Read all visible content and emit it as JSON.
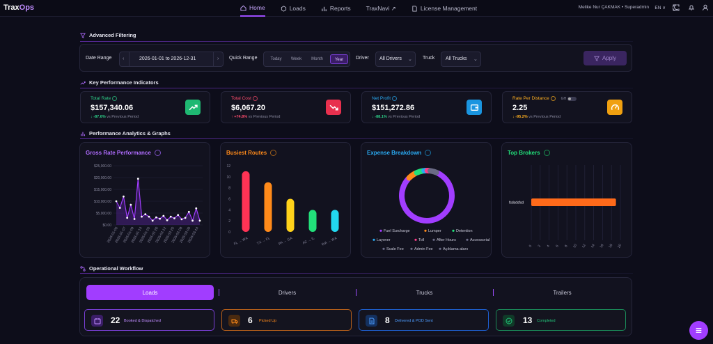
{
  "brand": {
    "name_a": "Trax",
    "name_b": "Ops"
  },
  "nav": [
    {
      "label": "Home",
      "icon": "home-icon"
    },
    {
      "label": "Loads",
      "icon": "box-icon"
    },
    {
      "label": "Reports",
      "icon": "bar-chart-icon"
    },
    {
      "label": "TraxNavi ↗",
      "icon": ""
    },
    {
      "label": "License Management",
      "icon": "document-icon"
    }
  ],
  "user": {
    "name": "Melike Nur ÇAKMAK • Superadmin",
    "lang": "EN ∨"
  },
  "sections": {
    "filtering": "Advanced Filtering",
    "kpi": "Key Performance Indicators",
    "analytics": "Performance Analytics & Graphs",
    "workflow": "Operational Workflow"
  },
  "filter": {
    "date_range_label": "Date Range",
    "date_range_value": "2026-01-01 to 2026-12-31",
    "quick_range_label": "Quick Range",
    "quick_options": [
      "Today",
      "Week",
      "Month",
      "Year"
    ],
    "quick_selected": "Year",
    "driver_label": "Driver",
    "driver_value": "All Drivers",
    "truck_label": "Truck",
    "truck_value": "All Trucks",
    "apply_label": "Apply"
  },
  "kpis": [
    {
      "label": "Total Rate",
      "value": "$157,340.06",
      "change": "-87.6%",
      "suffix": "vs Previous Period",
      "color": "#2ed18a"
    },
    {
      "label": "Total Cost",
      "value": "$6,067.20",
      "change": "+74.8%",
      "suffix": "vs Previous Period",
      "color": "#ff4d6d"
    },
    {
      "label": "Net Profit",
      "value": "$151,272.86",
      "change": "-88.1%",
      "suffix": "vs Previous Period",
      "color": "#2aa9f0"
    },
    {
      "label": "Rate Per Distance",
      "value": "2.25",
      "change": "-95.2%",
      "suffix": "vs Previous Period",
      "color": "#ffb020",
      "toggle_label": "GH"
    }
  ],
  "cards": {
    "gross": "Gross Rate Performance",
    "routes": "Busiest Routes",
    "expense": "Expense Breakdown",
    "brokers": "Top Brokers"
  },
  "chart_data": [
    {
      "type": "line",
      "title": "Gross Rate Performance",
      "x": [
        "2026-01-05",
        "2026-01-07",
        "2026-01-09",
        "2026-01-11",
        "2026-01-13",
        "2026-01-16",
        "2026-01-20",
        "2026-01-23",
        "2026-01-26",
        "2026-01-29",
        "2026-02-02",
        "2026-02-06",
        "2026-02-09",
        "2026-02-12",
        "2026-02-16",
        "2026-02-20",
        "2026-02-24",
        "2026-02-28",
        "2026-03-03",
        "2026-03-06",
        "2026-03-09",
        "2026-03-12",
        "2026-03-14",
        "2026-03-16"
      ],
      "x_tick_labels": [
        "2026-01-05",
        "2026-01-07",
        "2026-01-09",
        "2026-01-13",
        "2026-01-20",
        "2026-01-26",
        "2026-02-12",
        "2026-02-20",
        "2026-02-28",
        "2026-03-09",
        "2026-03-14"
      ],
      "values": [
        10000,
        7200,
        12000,
        3000,
        8500,
        2500,
        19500,
        3500,
        4500,
        3500,
        1800,
        3200,
        2600,
        3800,
        2000,
        3500,
        2800,
        4200,
        2400,
        3000,
        5500,
        1800,
        7000,
        1800
      ],
      "ylim": [
        0,
        25000
      ],
      "y_ticks": [
        "$0.00",
        "$5,000.00",
        "$10,000.00",
        "$15,000.00",
        "$20,000.00",
        "$25,000.00"
      ]
    },
    {
      "type": "bar",
      "title": "Busiest Routes",
      "categories": [
        "FL → WA",
        "TX → FL",
        "PA → GA",
        "AZ → IL",
        "WA → WA"
      ],
      "values": [
        11,
        9,
        6,
        4,
        4
      ],
      "colors": [
        "#ff3355",
        "#ff8a1a",
        "#ffd21a",
        "#22e07a",
        "#22d8f0"
      ],
      "ylim": [
        0,
        12
      ],
      "y_ticks": [
        0,
        2,
        4,
        6,
        8,
        10,
        12
      ]
    },
    {
      "type": "pie",
      "title": "Expense Breakdown",
      "labels": [
        "Fuel Surcharge",
        "Lumper",
        "Detention",
        "Layover",
        "Toll",
        "After Hours",
        "Accessorial",
        "Scale Fee",
        "Admin Fee",
        "Açıklama alanı"
      ],
      "values": [
        82,
        6,
        5,
        2,
        2,
        1,
        1,
        1,
        1,
        1
      ],
      "colors": [
        "#a13dff",
        "#ff8a1a",
        "#22e07a",
        "#2aa9f0",
        "#ff3d8a",
        "#6a6a85",
        "#6a6a85",
        "#6a6a85",
        "#6a6a85",
        "#6a6a85"
      ]
    },
    {
      "type": "bar",
      "orientation": "horizontal",
      "title": "Top Brokers",
      "categories": [
        "fsdsdsfsd"
      ],
      "values": [
        19
      ],
      "colors": [
        "#ff6a1a"
      ],
      "xlim": [
        0,
        20
      ],
      "x_ticks": [
        0,
        2,
        4,
        6,
        8,
        10,
        12,
        14,
        16,
        18,
        20
      ]
    }
  ],
  "workflow": {
    "tabs": [
      "Loads",
      "Drivers",
      "Trucks",
      "Trailers"
    ],
    "active_tab": "Loads",
    "items": [
      {
        "count": "22",
        "label": "Booked & Dispatched",
        "color": "#a13dff",
        "icon": "calendar-icon"
      },
      {
        "count": "6",
        "label": "Picked Up",
        "color": "#ff8a1a",
        "icon": "truck-icon"
      },
      {
        "count": "8",
        "label": "Delivered & POD Sent",
        "color": "#2a7bff",
        "icon": "document-icon"
      },
      {
        "count": "13",
        "label": "Completed",
        "color": "#22c47a",
        "icon": "check-circle-icon"
      }
    ]
  }
}
